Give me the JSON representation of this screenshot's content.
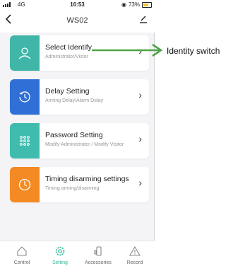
{
  "status_bar": {
    "network": "4G",
    "time": "10:53",
    "battery": "73%"
  },
  "nav": {
    "back_icon": "chevron-left-icon",
    "title": "WS02",
    "edit_icon": "edit-icon"
  },
  "cards": [
    {
      "title": "Select Identify",
      "subtitle": "Administrator/Vistor",
      "icon": "user-icon",
      "color": "#3fb6a7"
    },
    {
      "title": "Delay Setting",
      "subtitle": "Arming Delay/Alarm Delay",
      "icon": "timer-icon",
      "color": "#2f6fd6"
    },
    {
      "title": "Password Setting",
      "subtitle": "Modify Administrator / Modify Visitor",
      "icon": "keypad-icon",
      "color": "#3fbcae"
    },
    {
      "title": "Timing disarming settings",
      "subtitle": "Timing arming/disarming",
      "icon": "clock-icon",
      "color": "#f38a23"
    }
  ],
  "tabs": [
    {
      "label": "Control",
      "icon": "home-icon"
    },
    {
      "label": "Setting",
      "icon": "gear-icon",
      "active": true
    },
    {
      "label": "Accessories",
      "icon": "sensor-icon"
    },
    {
      "label": "Record",
      "icon": "alert-icon"
    }
  ],
  "annotation": {
    "text": "Identity switch",
    "color": "#4ea346"
  }
}
